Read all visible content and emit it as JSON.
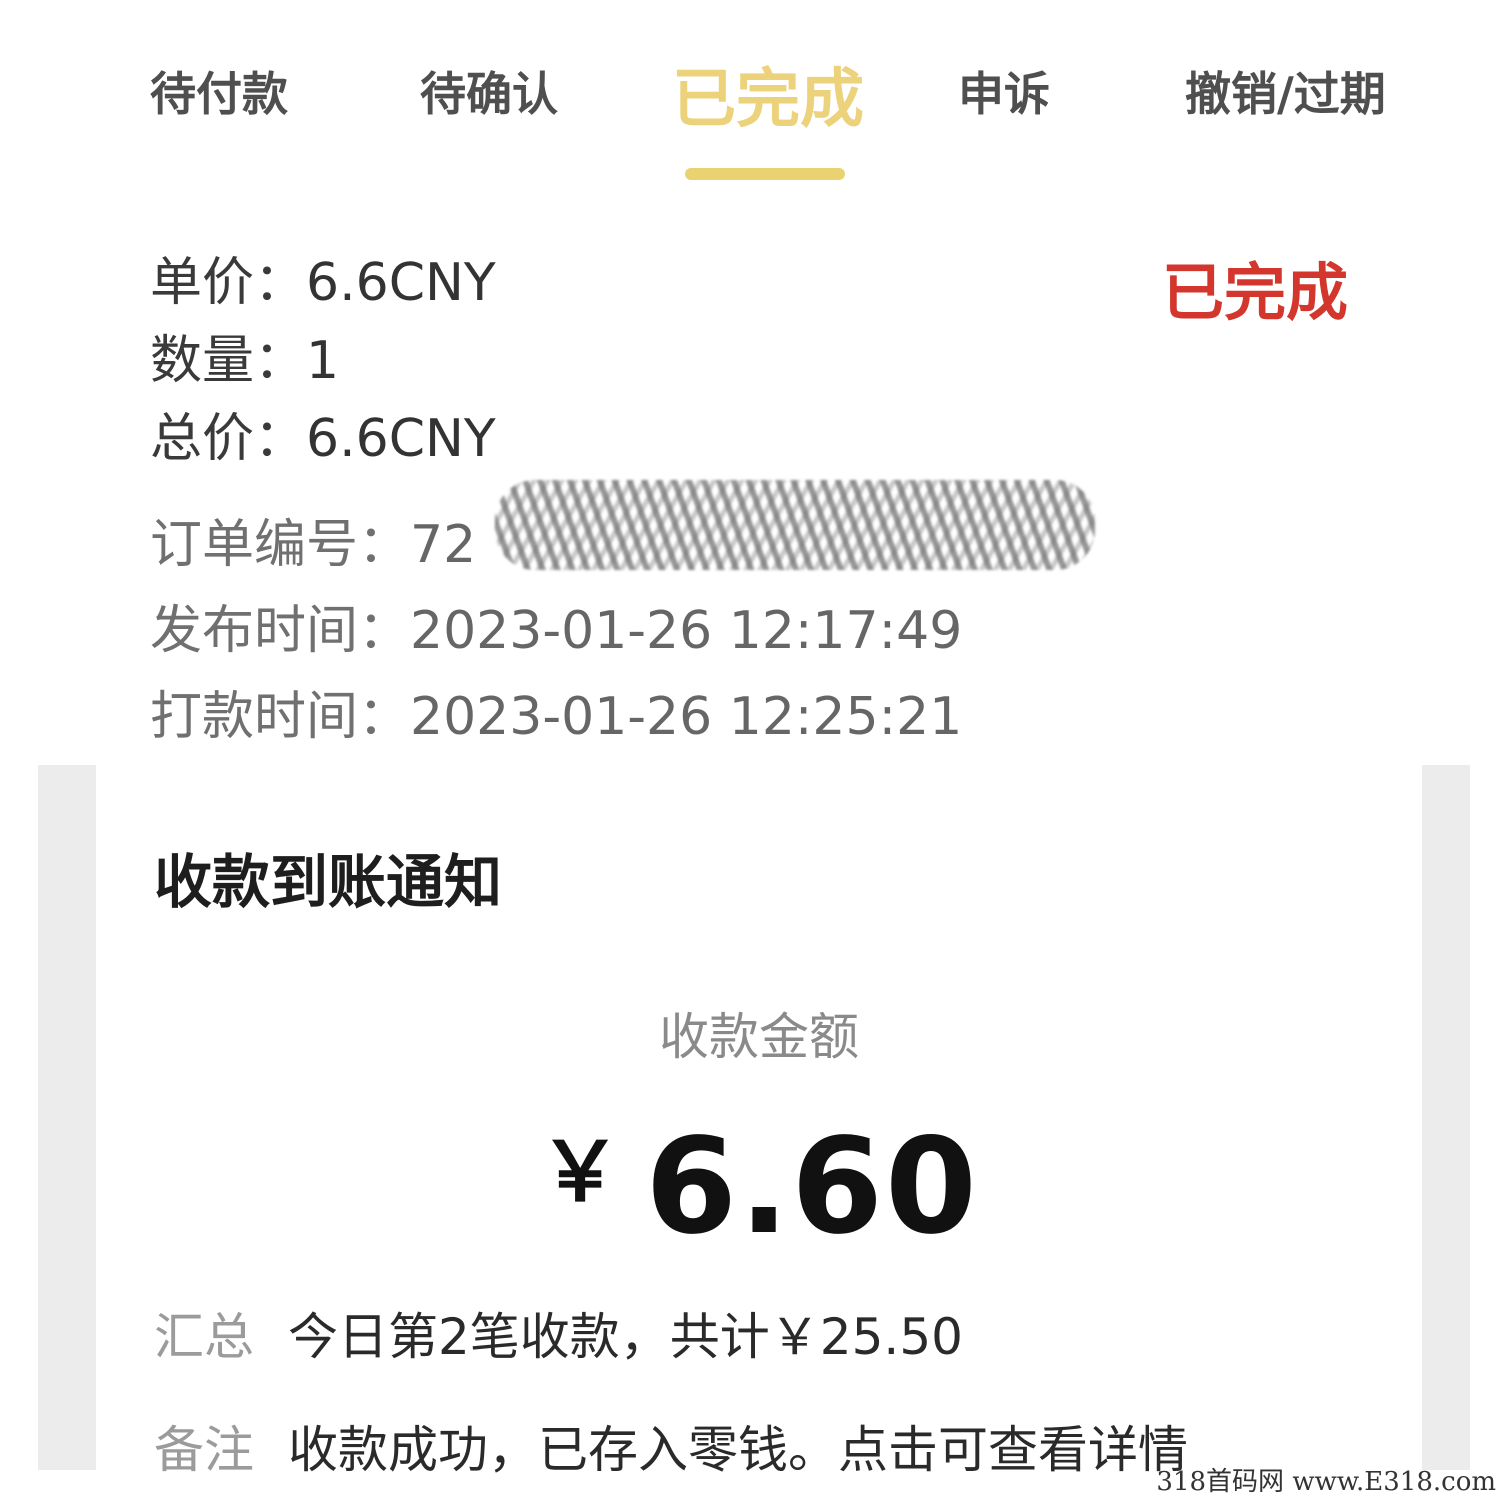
{
  "tabs": [
    {
      "label": "待付款",
      "active": false
    },
    {
      "label": "待确认",
      "active": false
    },
    {
      "label": "已完成",
      "active": true
    },
    {
      "label": "申诉",
      "active": false
    },
    {
      "label": "撤销/过期",
      "active": false
    }
  ],
  "order": {
    "status": "已完成",
    "unit_price_label": "单价：",
    "unit_price": "6.6CNY",
    "quantity_label": "数量：",
    "quantity": "1",
    "total_label": "总价：",
    "total": "6.6CNY",
    "order_no_label": "订单编号：",
    "order_no_visible": "72",
    "publish_time_label": "发布时间：",
    "publish_time": "2023-01-26 12:17:49",
    "pay_time_label": "打款时间：",
    "pay_time": "2023-01-26 12:25:21"
  },
  "notification": {
    "title": "收款到账通知",
    "amount_label": "收款金额",
    "currency": "￥",
    "amount": "6.60",
    "summary_label": "汇总",
    "summary": "今日第2笔收款，共计￥25.50",
    "remark_label": "备注",
    "remark": "收款成功，已存入零钱。点击可查看详情"
  },
  "watermark": "318首码网 www.E318.com",
  "colors": {
    "active_tab": "#ecd27a",
    "status_red": "#d3362d",
    "card_border": "#ececec"
  }
}
